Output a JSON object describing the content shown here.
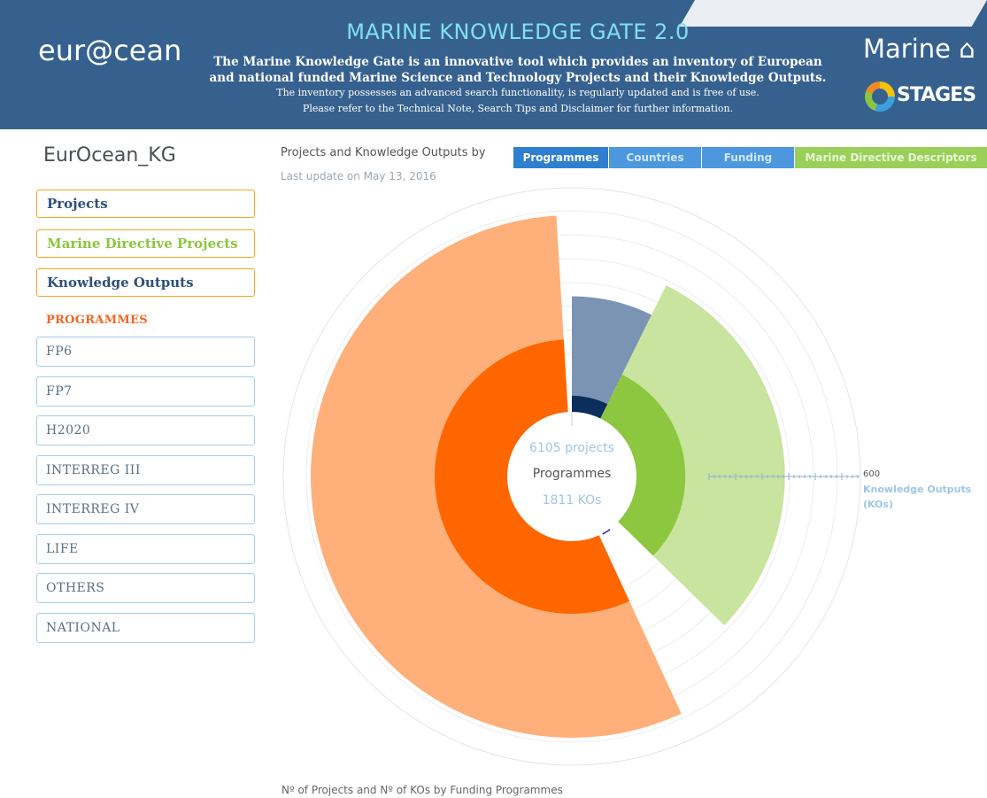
{
  "header": {
    "logo_left": "eur@cean",
    "title": "MARINE KNOWLEDGE GATE 2.0",
    "line1": "The Marine Knowledge Gate is an innovative tool which provides an inventory of European",
    "line2": "and national funded Marine Science and Technology Projects and their Knowledge Outputs.",
    "line3": "The inventory possesses an advanced search functionality, is regularly updated and is free of use.",
    "line4": "Please refer to the Technical Note, Search Tips and Disclaimer for further information.",
    "logo_marine": "Marine",
    "logo_stages": "STAGES",
    "background": "#36618f"
  },
  "sidebar": {
    "title": "EurOcean_KG",
    "buttons": [
      {
        "label": "Projects",
        "color": "#2f4f7c"
      },
      {
        "label": "Marine Directive Projects",
        "color": "#8dc63f"
      },
      {
        "label": "Knowledge Outputs",
        "color": "#2f4f7c"
      }
    ],
    "programmes_heading": "PROGRAMMES",
    "programmes": [
      "FP6",
      "FP7",
      "H2020",
      "INTERREG III",
      "INTERREG IV",
      "LIFE",
      "OTHERS",
      "NATIONAL"
    ]
  },
  "main": {
    "by_label": "Projects and Knowledge Outputs by",
    "last_update": "Last update on May 13, 2016",
    "tabs": [
      "Programmes",
      "Countries",
      "Funding",
      "Marine Directive Descriptors"
    ],
    "active_tab": "Programmes",
    "caption": "Nº of Projects and Nº of KOs by Funding Programmes"
  },
  "chart_data": {
    "type": "radial-bar",
    "center": {
      "projects": "6105 projects",
      "label": "Programmes",
      "kos": "1811 KOs"
    },
    "axis_label_value": "600",
    "axis_title_line1": "Knowledge Outputs",
    "axis_title_line2": "(KOs)",
    "series": [
      {
        "name": "Projects",
        "values": [
          450,
          1850,
          60,
          110,
          130,
          45,
          3450,
          10
        ]
      },
      {
        "name": "KOs",
        "values": [
          560,
          700,
          0,
          0,
          70,
          30,
          905,
          30
        ]
      }
    ],
    "project_colors": [
      "#0b2e5c",
      "#8dc63f",
      "#1a9a3a",
      "#1e9bf0",
      "#2211cc",
      "#ffc000",
      "#ff6600",
      "#2a0a99"
    ],
    "ko_colors": [
      "#7b94b3",
      "#c8e49e",
      "#9fd5ad",
      "#a8d8f8",
      "#9a8be6",
      "#ffe08a",
      "#ffb07a",
      "#9f88e0"
    ]
  }
}
